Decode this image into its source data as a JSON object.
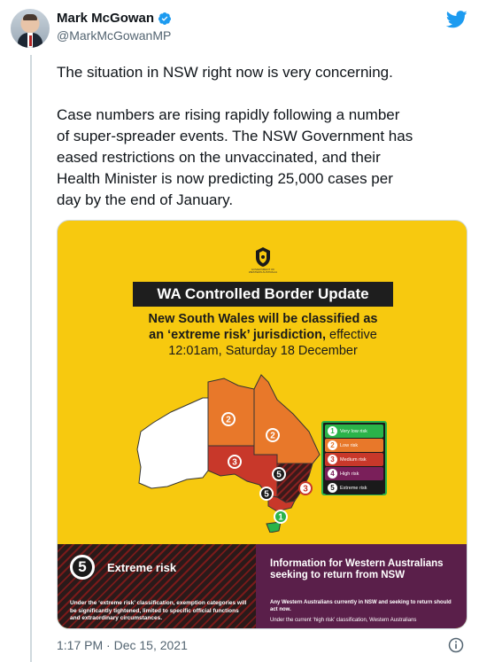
{
  "author": {
    "name": "Mark McGowan",
    "handle": "@MarkMcGowanMP",
    "verified": true
  },
  "tweet": {
    "paragraph1": "The situation in NSW right now is very concerning.",
    "paragraph2": "Case numbers are rising rapidly following a number\nof super-spreader events. The NSW Government has\neased restrictions on the unvaccinated, and their\nHealth Minister is now predicting 25,000 cases per\nday by the end of January.",
    "timestamp": "1:17 PM · Dec 15, 2021"
  },
  "media": {
    "crest_text": "GOVERNMENT OF WESTERN AUSTRALIA",
    "banner": "WA Controlled Border Update",
    "headline_bold1": "New South Wales will be classified as",
    "headline_bold2": "an ‘extreme risk’ jurisdiction,",
    "headline_normal2": " effective",
    "headline_line3": "12:01am, Saturday 18 December",
    "map_labels": {
      "nt": "2",
      "qld": "2",
      "sa": "3",
      "nsw": "5",
      "act": "5",
      "vic": "3",
      "tas": "1"
    },
    "legend": [
      {
        "num": "1",
        "label": "Very low risk",
        "color": "#2bb34a"
      },
      {
        "num": "2",
        "label": "Low risk",
        "color": "#e8782a"
      },
      {
        "num": "3",
        "label": "Medium risk",
        "color": "#c8382a"
      },
      {
        "num": "4",
        "label": "High risk",
        "color": "#7a1f5a"
      },
      {
        "num": "5",
        "label": "Extreme risk",
        "color": "#1a1a1a"
      }
    ],
    "left_panel": {
      "num": "5",
      "title": "Extreme risk",
      "body": "Under the ‘extreme risk’ classification, exemption categories will be significantly tightened, limited to specific official functions and extraordinary circumstances."
    },
    "right_panel": {
      "title": "Information for Western Australians seeking to return from NSW",
      "body1": "Any Western Australians currently in NSW and seeking to return should act now.",
      "body2": "Under the current ‘high risk’ classification, Western Australians"
    }
  },
  "colors": {
    "accent": "#1d9bf0",
    "poster_yellow": "#f7c90f",
    "text_secondary": "#536471"
  }
}
